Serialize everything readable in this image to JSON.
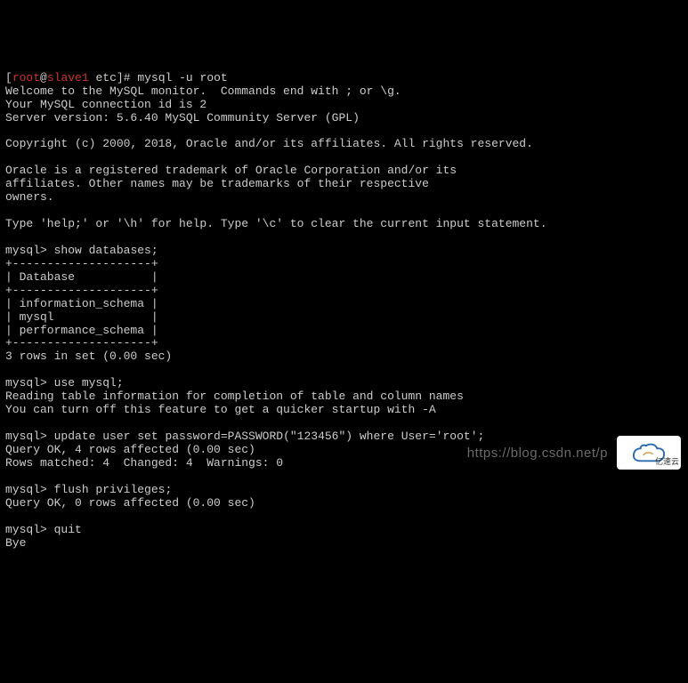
{
  "prompt": {
    "user": "root",
    "host": "slave1",
    "cwd": "etc",
    "symbol": "#",
    "command": "mysql -u root"
  },
  "welcome": {
    "line1": "Welcome to the MySQL monitor.  Commands end with ; or \\g.",
    "line2": "Your MySQL connection id is 2",
    "line3": "Server version: 5.6.40 MySQL Community Server (GPL)"
  },
  "copyright": "Copyright (c) 2000, 2018, Oracle and/or its affiliates. All rights reserved.",
  "trademark": {
    "line1": "Oracle is a registered trademark of Oracle Corporation and/or its",
    "line2": "affiliates. Other names may be trademarks of their respective",
    "line3": "owners."
  },
  "help_hint": "Type 'help;' or '\\h' for help. Type '\\c' to clear the current input statement.",
  "mysql_prompt": "mysql>",
  "cmd_show_db": "show databases;",
  "db_table": {
    "border": "+--------------------+",
    "header": "| Database           |",
    "rows": [
      "| information_schema |",
      "| mysql              |",
      "| performance_schema |"
    ],
    "summary": "3 rows in set (0.00 sec)"
  },
  "cmd_use": "use mysql;",
  "use_output": {
    "line1": "Reading table information for completion of table and column names",
    "line2": "You can turn off this feature to get a quicker startup with -A"
  },
  "cmd_update": "update user set password=PASSWORD(\"123456\") where User='root';",
  "update_output": {
    "line1": "Query OK, 4 rows affected (0.00 sec)",
    "line2": "Rows matched: 4  Changed: 4  Warnings: 0"
  },
  "cmd_flush": "flush privileges;",
  "flush_output": "Query OK, 0 rows affected (0.00 sec)",
  "cmd_quit": "quit",
  "bye": "Bye",
  "watermark": "https://blog.csdn.net/p",
  "logo_text": "亿速云"
}
